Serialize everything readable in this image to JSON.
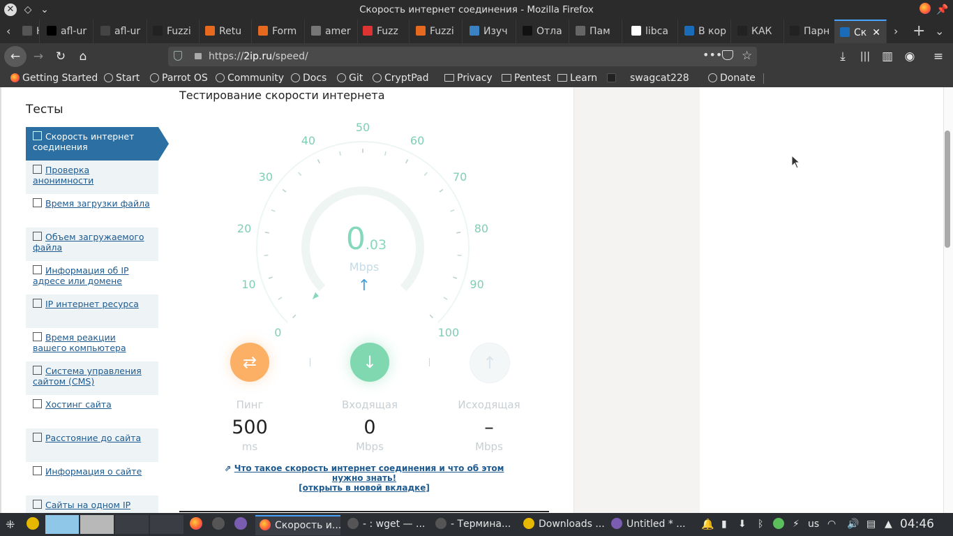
{
  "window": {
    "title": "Скорость интернет соединения - Mozilla Firefox"
  },
  "tabs": [
    {
      "label": "Н",
      "icon": "page-icon"
    },
    {
      "label": "afl-ur",
      "icon": "medium-icon"
    },
    {
      "label": "afl-ur",
      "icon": "afl-icon"
    },
    {
      "label": "Fuzzi",
      "icon": "fuzz-icon"
    },
    {
      "label": "Retu",
      "icon": "blogger-icon"
    },
    {
      "label": "Form",
      "icon": "blogger-icon"
    },
    {
      "label": "amer",
      "icon": "lock-icon"
    },
    {
      "label": "Fuzz",
      "icon": "star-icon"
    },
    {
      "label": "Fuzzi",
      "icon": "blog-icon"
    },
    {
      "label": "Изуч",
      "icon": "gear-icon"
    },
    {
      "label": "Отла",
      "icon": "linux-icon"
    },
    {
      "label": "Пам",
      "icon": "grid-icon"
    },
    {
      "label": "libca",
      "icon": "google-icon"
    },
    {
      "label": "В кор",
      "icon": "arrow-icon"
    },
    {
      "label": "КАК",
      "icon": "site-icon"
    },
    {
      "label": "Парн",
      "icon": "site-icon"
    },
    {
      "label": "Ск",
      "icon": "ip-icon"
    }
  ],
  "navbar": {
    "url_prefix": "https://",
    "url_host": "2ip.ru",
    "url_path": "/speed/"
  },
  "bookmarks": [
    {
      "label": "Getting Started",
      "icon": "firefox-icon"
    },
    {
      "label": "Start",
      "icon": "globe-icon"
    },
    {
      "label": "Parrot OS",
      "icon": "globe-icon"
    },
    {
      "label": "Community",
      "icon": "globe-icon"
    },
    {
      "label": "Docs",
      "icon": "globe-icon"
    },
    {
      "label": "Git",
      "icon": "globe-icon"
    },
    {
      "label": "CryptPad",
      "icon": "globe-icon"
    },
    {
      "label": "Privacy",
      "icon": "folder-icon"
    },
    {
      "label": "Pentest",
      "icon": "folder-icon"
    },
    {
      "label": "Learn",
      "icon": "folder-icon"
    },
    {
      "label": "swagcat228",
      "icon": "site-icon"
    },
    {
      "label": "Donate",
      "icon": "globe-icon"
    }
  ],
  "page": {
    "heading": "Тестирование скорости интернета",
    "sidebar_title": "Тесты",
    "sidebar_items": [
      {
        "label": "Скорость интернет соединения"
      },
      {
        "label": "Проверка анонимности"
      },
      {
        "label": "Время загрузки файла"
      },
      {
        "label": "Объем загружаемого файла"
      },
      {
        "label": "Информация об IP адресе или домене"
      },
      {
        "label": "IP интернет ресурса"
      },
      {
        "label": "Время реакции вашего компьютера"
      },
      {
        "label": "Система управления сайтом (CMS)"
      },
      {
        "label": "Хостинг сайта"
      },
      {
        "label": "Расстояние до сайта"
      },
      {
        "label": "Информация о сайте"
      },
      {
        "label": "Сайты на одном IP"
      }
    ],
    "gauge": {
      "ticks": [
        "0",
        "10",
        "20",
        "30",
        "40",
        "50",
        "60",
        "70",
        "80",
        "90",
        "100"
      ],
      "speed_int": "0",
      "speed_frac": ".03",
      "unit": "Mbps",
      "level_fraction": 0.0003
    },
    "stats": {
      "ping": {
        "label": "Пинг",
        "value": "500",
        "unit": "ms"
      },
      "download": {
        "label": "Входящая",
        "value": "0",
        "unit": "Mbps"
      },
      "upload": {
        "label": "Исходящая",
        "value": "–",
        "unit": "Mbps"
      }
    },
    "info_link": "Что такое скорость интернет соединения и что об этом нужно знать!",
    "info_link_new_tab": "[открыть в новой вкладке]"
  },
  "taskbar": {
    "apps": [
      {
        "label": "Скорость и...",
        "icon": "firefox-icon"
      },
      {
        "label": "- : wget — ...",
        "icon": "terminal-icon"
      },
      {
        "label": "-  Термина...",
        "icon": "terminal-icon"
      },
      {
        "label": "Downloads ...",
        "icon": "folder-icon"
      },
      {
        "label": "Untitled * ...",
        "icon": "editor-icon"
      }
    ],
    "keyboard_layout": "us",
    "clock": "04:46"
  }
}
